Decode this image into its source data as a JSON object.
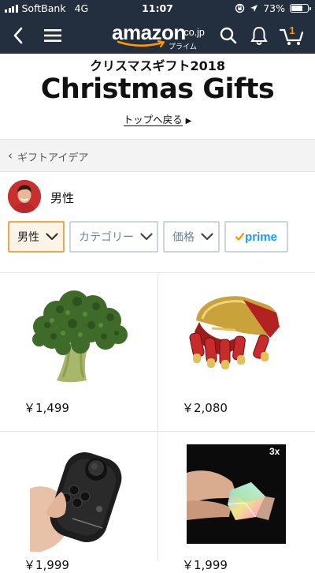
{
  "status_bar": {
    "carrier": "SoftBank",
    "network": "4G",
    "time": "11:07",
    "battery": "73%",
    "battery_level": 0.73
  },
  "header": {
    "logo_text": "amazon",
    "logo_tld": ".co.jp",
    "logo_sub": "プライム",
    "cart_count": "1",
    "icons": [
      "back-chevron-icon",
      "menu-icon",
      "search-icon",
      "bell-icon",
      "cart-icon"
    ],
    "bg_color": "#232f3e",
    "accent_color": "#ff9900"
  },
  "banner": {
    "subtitle": "クリスマスギフト2018",
    "title": "Christmas Gifts",
    "back_link": "トップへ戻る"
  },
  "breadcrumb": {
    "label": "ギフトアイデア"
  },
  "persona": {
    "label": "男性"
  },
  "filters": [
    {
      "label": "男性",
      "active": true
    },
    {
      "label": "カテゴリー",
      "active": false
    },
    {
      "label": "価格",
      "active": false
    },
    {
      "label": "prime",
      "active": false
    }
  ],
  "products": [
    {
      "name": "broccoli",
      "price": "￥1,499"
    },
    {
      "name": "iron-hand-figure",
      "price": "￥2,080"
    },
    {
      "name": "bluetooth-controller",
      "price": "￥1,999"
    },
    {
      "name": "prism-cube",
      "price": "￥1,999",
      "badge": "3x"
    }
  ]
}
